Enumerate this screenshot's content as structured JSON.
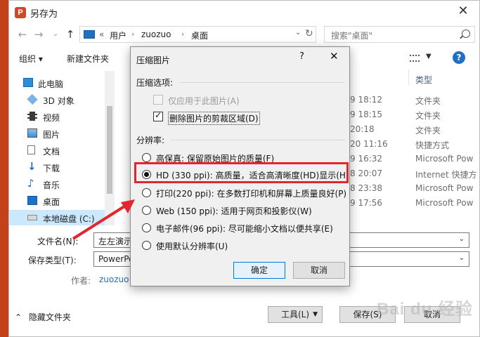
{
  "window": {
    "title": "另存为",
    "app_icon": "P"
  },
  "nav": {
    "breadcrumb": [
      "用户",
      "zuozuo",
      "桌面"
    ],
    "search_placeholder": "搜索\"桌面\""
  },
  "toolbar": {
    "organize": "组织 ▾",
    "new_folder": "新建文件夹"
  },
  "sidebar": {
    "items": [
      {
        "label": "此电脑",
        "icon": "computer-icon"
      },
      {
        "label": "3D 对象",
        "icon": "cube-icon"
      },
      {
        "label": "视频",
        "icon": "video-icon"
      },
      {
        "label": "图片",
        "icon": "picture-icon"
      },
      {
        "label": "文档",
        "icon": "document-icon"
      },
      {
        "label": "下载",
        "icon": "download-icon"
      },
      {
        "label": "音乐",
        "icon": "music-icon"
      },
      {
        "label": "桌面",
        "icon": "desktop-icon"
      },
      {
        "label": "本地磁盘 (C:)",
        "icon": "drive-icon"
      }
    ]
  },
  "files": {
    "type_header": "类型",
    "rows": [
      {
        "date": "9 18:12",
        "type": "文件夹"
      },
      {
        "date": "9 18:15",
        "type": "文件夹"
      },
      {
        "date": "20:18",
        "type": "文件夹"
      },
      {
        "date": "20 11:16",
        "type": "快捷方式"
      },
      {
        "date": "9 16:32",
        "type": "Microsoft Pow"
      },
      {
        "date": "8 20:07",
        "type": "Internet 快捷方"
      },
      {
        "date": "8 23:38",
        "type": "Microsoft Pow"
      },
      {
        "date": "9 17:56",
        "type": "Microsoft Pow"
      }
    ]
  },
  "form": {
    "filename_label": "文件名(N):",
    "filename_value": "左左演示",
    "filetype_label": "保存类型(T):",
    "filetype_value": "PowerPo",
    "author_label": "作者:",
    "author_value": "zuozuo"
  },
  "footer": {
    "hide_folders": "隐藏文件夹",
    "tools": "工具(L)",
    "save": "保存(S)",
    "cancel": "取消"
  },
  "dialog": {
    "title": "压缩图片",
    "help": "?",
    "options_head": "压缩选项:",
    "apply_only": "仅应用于此图片(A)",
    "delete_cropped": "删除图片的剪裁区域(D)",
    "resolution_head": "分辨率:",
    "resolutions": [
      {
        "label": "高保真: 保留原始图片的质量(F)",
        "selected": false
      },
      {
        "label": "HD (330 ppi): 高质量，适合高清晰度(HD)显示(H)",
        "selected": true
      },
      {
        "label": "打印(220 ppi): 在多数打印机和屏幕上质量良好(P)",
        "selected": false
      },
      {
        "label": "Web (150 ppi): 适用于网页和投影仪(W)",
        "selected": false
      },
      {
        "label": "电子邮件(96 ppi): 尽可能缩小文档以便共享(E)",
        "selected": false
      },
      {
        "label": "使用默认分辨率(U)",
        "selected": false
      }
    ],
    "ok": "确定",
    "cancel": "取消"
  },
  "colors": {
    "highlight": "#e3262d",
    "ppt_orange": "#c4421a",
    "link_blue": "#1f6fc5"
  },
  "watermark": "Bai du 经验"
}
